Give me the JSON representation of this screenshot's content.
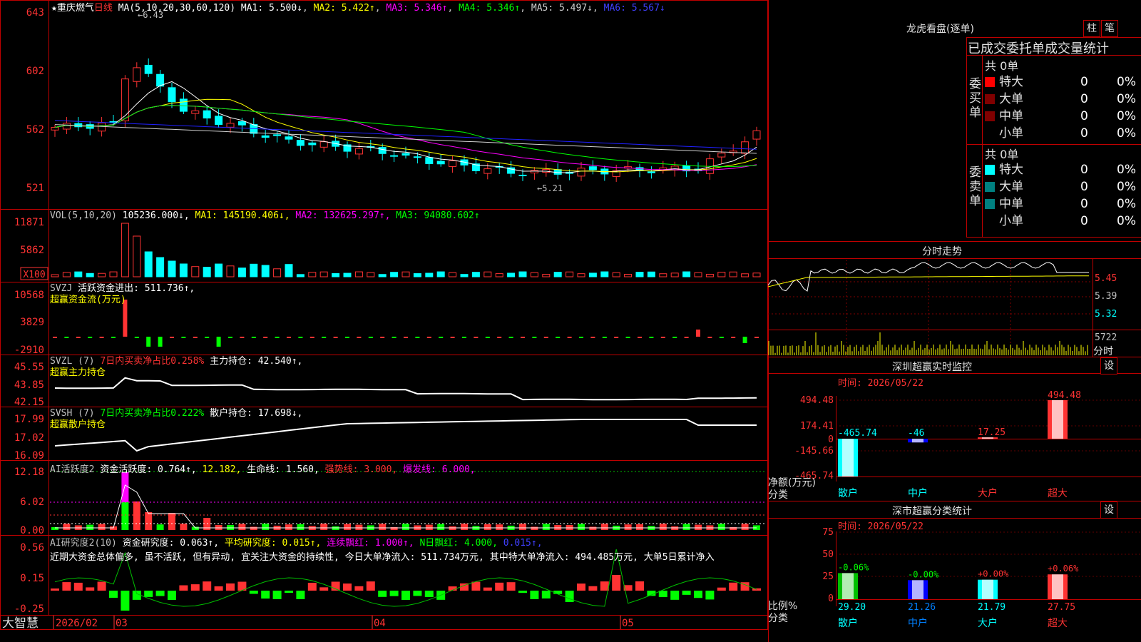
{
  "colors": {
    "up": "#ff3333",
    "down": "#00ffff",
    "bg": "#000000",
    "border": "#c00000",
    "ma1": "#ffffff",
    "ma2": "#ffff00",
    "ma3": "#ff00ff",
    "ma4": "#00ff00",
    "ma5": "#d0d0d0",
    "ma6": "#2020ff"
  },
  "header": {
    "star": "★",
    "stock_name": "重庆燃气",
    "period": "日线",
    "ma_label": "MA(5,10,20,30,60,120)",
    "ma1": "MA1: 5.500↓",
    "ma2": "MA2: 5.422↑",
    "ma3": "MA3: 5.346↑",
    "ma4": "MA4: 5.346↑",
    "ma5": "MA5: 5.497↓",
    "ma6": "MA6: 5.567↓",
    "hi_mark": "←6.43",
    "lo_mark": "←5.21"
  },
  "price_axis": [
    "643",
    "602",
    "562",
    "521"
  ],
  "vol": {
    "label": "VOL(5,10,20)",
    "value": "105236.000↓,",
    "ma1": "MA1: 145190.406↓,",
    "ma2": "MA2: 132625.297↑,",
    "ma3": "MA3: 94080.602↑",
    "axis": [
      "11871",
      "5862"
    ],
    "unit": "X100"
  },
  "svzj": {
    "label": "SVZJ",
    "text1": "活跃资金进出: 511.736↑,",
    "text2": "超赢资金流(万元)",
    "axis": [
      "10568",
      "3829",
      "-2910"
    ]
  },
  "svzl": {
    "label": "SVZL (7)",
    "text1": "7日内买卖净占比0.258%",
    "text2": "主力持仓: 42.540↑,",
    "text3": "超赢主力持仓",
    "axis": [
      "45.55",
      "43.85",
      "42.15"
    ]
  },
  "svsh": {
    "label": "SVSH (7)",
    "text1": "7日内买卖净占比0.222%",
    "text2": "散户持仓: 17.698↓,",
    "text3": "超赢散户持仓",
    "axis": [
      "17.99",
      "17.02",
      "16.09"
    ]
  },
  "ai1": {
    "label": "AI活跃度2",
    "t1": "资金活跃度: 0.764↑,",
    "t2": "12.182,",
    "t3": "生命线: 1.560,",
    "t4": "强势线: 3.000,",
    "t5": "爆发线: 6.000,",
    "axis": [
      "12.18",
      "6.02",
      "0.00"
    ]
  },
  "ai2": {
    "label": "AI研究度2(10)",
    "t1": "资金研究度: 0.063↑,",
    "t2": "平均研究度: 0.015↑,",
    "t3": "连续飘红: 1.000↑,",
    "t4": "N日飘红: 4.000,",
    "t5": "0.015↑,",
    "comment": "近期大资金总体偏多, 虽不活跃, 但有异动, 宜关注大资金的持续性, 今日大单净流入: 511.734万元, 其中特大单净流入: 494.485万元, 大单5日累计净入",
    "axis": [
      "0.56",
      "0.15",
      "-0.25"
    ]
  },
  "date_axis": [
    "2026/02",
    "03",
    "04",
    "05"
  ],
  "brand": "大智慧",
  "right": {
    "lhb_title": "龙虎看盘(逐单)",
    "btn_zhu": "柱",
    "btn_bi": "笔",
    "stat_title": "已成交委托单成交量统计",
    "buy": {
      "side": "委买单",
      "total": "共 0单",
      "rows": [
        {
          "name": "特大",
          "val": "0",
          "pct": "0%",
          "color": "#ff0000"
        },
        {
          "name": "大单",
          "val": "0",
          "pct": "0%",
          "color": "#800000"
        },
        {
          "name": "中单",
          "val": "0",
          "pct": "0%",
          "color": "#800000"
        },
        {
          "name": "小单",
          "val": "0",
          "pct": "0%",
          "color": "#000000"
        }
      ]
    },
    "sell": {
      "side": "委卖单",
      "total": "共 0单",
      "rows": [
        {
          "name": "特大",
          "val": "0",
          "pct": "0%",
          "color": "#00ffff"
        },
        {
          "name": "大单",
          "val": "0",
          "pct": "0%",
          "color": "#008080"
        },
        {
          "name": "中单",
          "val": "0",
          "pct": "0%",
          "color": "#008080"
        },
        {
          "name": "小单",
          "val": "0",
          "pct": "0%",
          "color": "#000000"
        }
      ]
    },
    "fenshi_title": "分时走势",
    "fenshi_axis": [
      "5.45",
      "5.39",
      "5.32"
    ],
    "fenshi_vol": "5722",
    "fenshi_unit": "分时",
    "sz_title": "深圳超赢实时监控",
    "sz_set": "设",
    "sz_time": "时间: 2026/05/22",
    "sz_axis": [
      "494.48",
      "174.41",
      "0",
      "-145.66",
      "-465.74"
    ],
    "sz_unit": "净额(万元)",
    "sz_cat": "分类",
    "cls_title": "深市超赢分类统计",
    "cls_set": "设",
    "cls_time": "时间: 2026/05/22",
    "cls_axis": [
      "75",
      "50",
      "25",
      "0"
    ],
    "cls_unit": "比例%",
    "cls_cat": "分类"
  },
  "chart_data": [
    {
      "type": "bar",
      "title": "深圳超赢实时监控",
      "categories": [
        "散户",
        "中户",
        "大户",
        "超大"
      ],
      "values": [
        -465.74,
        -46,
        17.25,
        494.48
      ],
      "labels": [
        "-465.74",
        "-46",
        "17.25",
        "494.48"
      ],
      "ylim": [
        -465.74,
        494.48
      ]
    },
    {
      "type": "bar",
      "title": "深市超赢分类统计",
      "categories": [
        "散户",
        "中户",
        "大户",
        "超大"
      ],
      "values": [
        29.2,
        21.26,
        21.79,
        27.75
      ],
      "changes": [
        "-0.06%",
        "-0.00%",
        "+0.00%",
        "+0.06%"
      ],
      "value_labels": [
        "29.20",
        "21.26",
        "21.79",
        "27.75"
      ],
      "ylim": [
        0,
        75
      ]
    }
  ]
}
